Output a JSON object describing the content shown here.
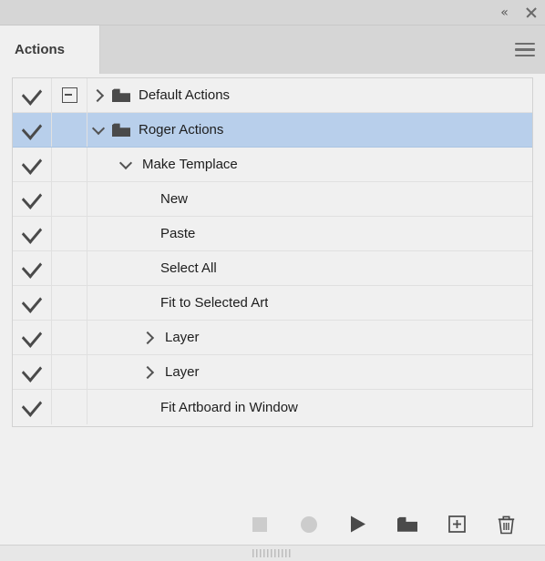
{
  "window": {
    "collapse_label": "«",
    "close_label": "✕",
    "collapse_icon": "double-chevron-left-icon",
    "close_icon": "close-icon"
  },
  "tabs": [
    {
      "label": "Actions",
      "active": true
    }
  ],
  "panel_menu": {
    "icon": "hamburger-menu-icon",
    "label": "Panel Menu"
  },
  "list": {
    "columns": [
      "toggle-on-off",
      "toggle-dialog",
      "name"
    ],
    "rows": [
      {
        "label": "Default Actions",
        "checked": true,
        "dialog_toggle": "minus-box",
        "disclosure": "right",
        "icon": "folder-icon",
        "indent": 0,
        "selected": false,
        "type": "action-set"
      },
      {
        "label": "Roger Actions",
        "checked": true,
        "dialog_toggle": null,
        "disclosure": "down",
        "icon": "folder-icon",
        "indent": 0,
        "selected": true,
        "type": "action-set"
      },
      {
        "label": "Make Templace",
        "checked": true,
        "dialog_toggle": null,
        "disclosure": "down",
        "icon": null,
        "indent": 1,
        "selected": false,
        "type": "action"
      },
      {
        "label": "New",
        "checked": true,
        "dialog_toggle": null,
        "disclosure": null,
        "icon": null,
        "indent": 3,
        "selected": false,
        "type": "command"
      },
      {
        "label": "Paste",
        "checked": true,
        "dialog_toggle": null,
        "disclosure": null,
        "icon": null,
        "indent": 3,
        "selected": false,
        "type": "command"
      },
      {
        "label": "Select All",
        "checked": true,
        "dialog_toggle": null,
        "disclosure": null,
        "icon": null,
        "indent": 3,
        "selected": false,
        "type": "command"
      },
      {
        "label": "Fit to Selected Art",
        "checked": true,
        "dialog_toggle": null,
        "disclosure": null,
        "icon": null,
        "indent": 3,
        "selected": false,
        "type": "command"
      },
      {
        "label": "Layer",
        "checked": true,
        "dialog_toggle": null,
        "disclosure": "right",
        "icon": null,
        "indent": 2,
        "selected": false,
        "type": "command"
      },
      {
        "label": "Layer",
        "checked": true,
        "dialog_toggle": null,
        "disclosure": "right",
        "icon": null,
        "indent": 2,
        "selected": false,
        "type": "command"
      },
      {
        "label": "Fit Artboard in Window",
        "checked": true,
        "dialog_toggle": null,
        "disclosure": null,
        "icon": null,
        "indent": 3,
        "selected": false,
        "type": "command"
      }
    ]
  },
  "toolbar": {
    "buttons": [
      {
        "name": "stop-playing-button",
        "icon": "stop-square-icon",
        "label": "Stop Playing/Recording",
        "enabled": false
      },
      {
        "name": "begin-recording-button",
        "icon": "record-circle-icon",
        "label": "Begin Recording",
        "enabled": false
      },
      {
        "name": "play-selection-button",
        "icon": "play-triangle-icon",
        "label": "Play Current Selection",
        "enabled": true
      },
      {
        "name": "create-new-set-button",
        "icon": "folder-icon",
        "label": "Create New Set",
        "enabled": true
      },
      {
        "name": "create-new-action-button",
        "icon": "new-document-plus-icon",
        "label": "Create New Action",
        "enabled": true
      },
      {
        "name": "delete-selection-button",
        "icon": "trash-icon",
        "label": "Delete Selection",
        "enabled": true
      }
    ]
  },
  "status": {
    "resize_grip": "resize-grip-icon"
  },
  "colors": {
    "selection": "#b8cfeb",
    "panel_bg": "#f0f0f0",
    "chrome_bg": "#d6d6d6",
    "icon_dark": "#4a4a4a",
    "icon_disabled": "#cccccc"
  }
}
